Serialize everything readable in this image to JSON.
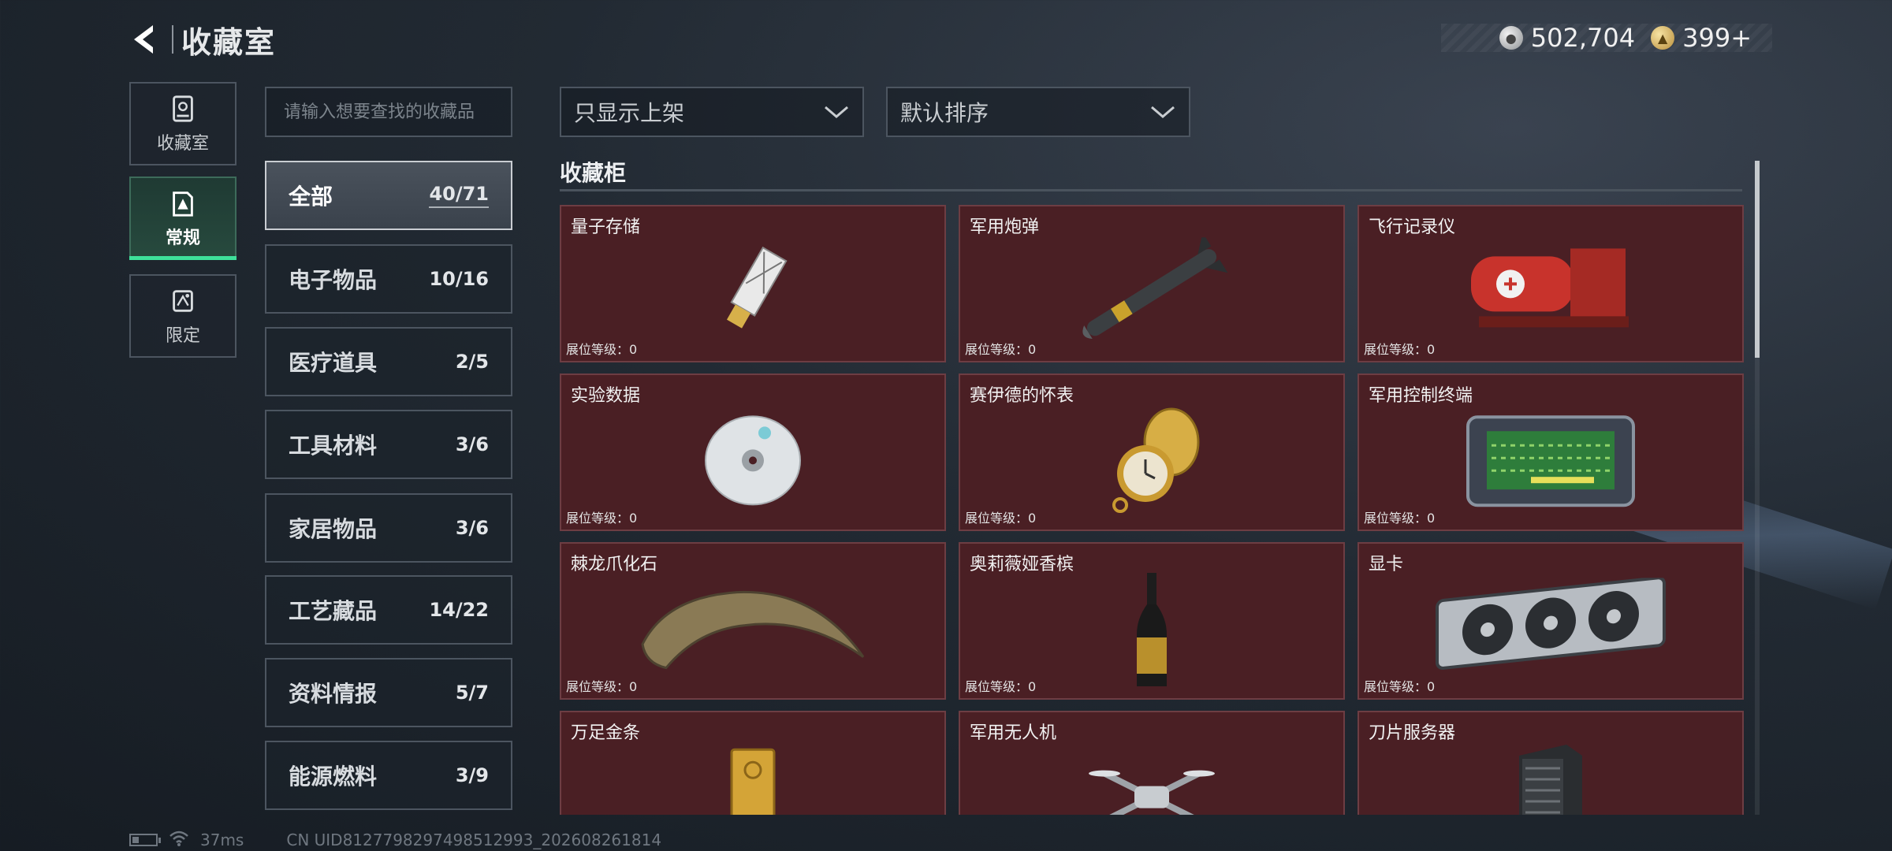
{
  "header": {
    "title": "收藏室",
    "currency": [
      {
        "icon": "silver-coin-icon",
        "value": "502,704"
      },
      {
        "icon": "gold-coin-icon",
        "value": "399+"
      }
    ]
  },
  "mode_tabs": [
    {
      "label": "收藏室",
      "icon": "trophy-cabinet-icon",
      "active": false
    },
    {
      "label": "常规",
      "icon": "triangle-card-icon",
      "active": true
    },
    {
      "label": "限定",
      "icon": "limited-card-icon",
      "active": false
    }
  ],
  "search": {
    "placeholder": "请输入想要查找的收藏品"
  },
  "categories": [
    {
      "name": "全部",
      "count": "40/71",
      "active": true
    },
    {
      "name": "电子物品",
      "count": "10/16"
    },
    {
      "name": "医疗道具",
      "count": "2/5"
    },
    {
      "name": "工具材料",
      "count": "3/6"
    },
    {
      "name": "家居物品",
      "count": "3/6"
    },
    {
      "name": "工艺藏品",
      "count": "14/22"
    },
    {
      "name": "资料情报",
      "count": "5/7"
    },
    {
      "name": "能源燃料",
      "count": "3/9"
    }
  ],
  "filters": {
    "display_filter": "只显示上架",
    "sort": "默认排序"
  },
  "cabinet": {
    "title": "收藏柜",
    "level_label": "展位等级：",
    "items": [
      {
        "name": "量子存储",
        "level": "0",
        "icon": "usb-drive-icon"
      },
      {
        "name": "军用炮弹",
        "level": "0",
        "icon": "missile-icon"
      },
      {
        "name": "飞行记录仪",
        "level": "0",
        "icon": "flight-recorder-icon"
      },
      {
        "name": "实验数据",
        "level": "0",
        "icon": "disc-icon"
      },
      {
        "name": "赛伊德的怀表",
        "level": "0",
        "icon": "pocket-watch-icon"
      },
      {
        "name": "军用控制终端",
        "level": "0",
        "icon": "control-terminal-icon"
      },
      {
        "name": "棘龙爪化石",
        "level": "0",
        "icon": "claw-fossil-icon"
      },
      {
        "name": "奥莉薇娅香槟",
        "level": "0",
        "icon": "champagne-icon"
      },
      {
        "name": "显卡",
        "level": "0",
        "icon": "graphics-card-icon"
      },
      {
        "name": "万足金条",
        "level": "",
        "icon": "gold-bar-icon"
      },
      {
        "name": "军用无人机",
        "level": "",
        "icon": "drone-icon"
      },
      {
        "name": "刀片服务器",
        "level": "",
        "icon": "blade-server-icon"
      }
    ]
  },
  "footer": {
    "ping": "37ms",
    "uid": "CN UID8127798297498512993_202608261814"
  }
}
